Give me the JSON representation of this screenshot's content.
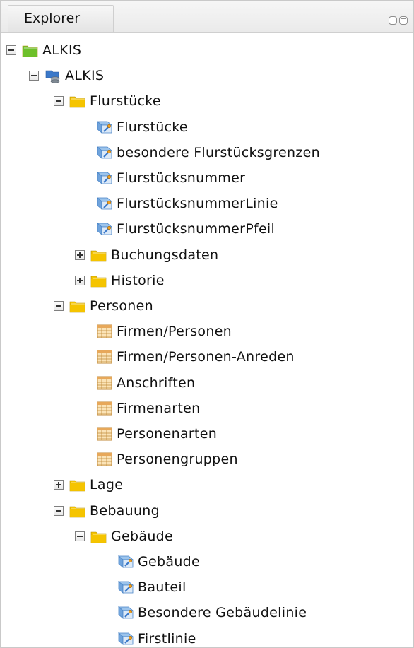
{
  "explorer": {
    "tab_label": "Explorer"
  },
  "icons": {
    "minimize": "minimize-icon",
    "maximize": "maximize-icon",
    "toggle_expanded": "collapse-icon",
    "toggle_collapsed": "expand-icon",
    "folder": "folder-icon",
    "folder_green": "green-folder-icon",
    "database": "database-icon",
    "layer": "map-layer-icon",
    "table": "table-icon"
  },
  "colors": {
    "folder_yellow": "#f5c400",
    "folder_green": "#6fbf2a",
    "layer_blue": "#3a78c9"
  },
  "tree": [
    {
      "label": "ALKIS",
      "icon": "folder_green",
      "toggle": "expanded"
    },
    {
      "label": "ALKIS",
      "icon": "database",
      "toggle": "expanded"
    },
    {
      "label": "Flurstücke",
      "icon": "folder",
      "toggle": "expanded"
    },
    {
      "label": "Flurstücke",
      "icon": "layer",
      "toggle": ""
    },
    {
      "label": "besondere Flurstücksgrenzen",
      "icon": "layer",
      "toggle": ""
    },
    {
      "label": "Flurstücksnummer",
      "icon": "layer",
      "toggle": ""
    },
    {
      "label": "FlurstücksnummerLinie",
      "icon": "layer",
      "toggle": ""
    },
    {
      "label": "FlurstücksnummerPfeil",
      "icon": "layer",
      "toggle": ""
    },
    {
      "label": "Buchungsdaten",
      "icon": "folder",
      "toggle": "collapsed"
    },
    {
      "label": "Historie",
      "icon": "folder",
      "toggle": "collapsed"
    },
    {
      "label": "Personen",
      "icon": "folder",
      "toggle": "expanded"
    },
    {
      "label": "Firmen/Personen",
      "icon": "table",
      "toggle": ""
    },
    {
      "label": "Firmen/Personen-Anreden",
      "icon": "table",
      "toggle": ""
    },
    {
      "label": "Anschriften",
      "icon": "table",
      "toggle": ""
    },
    {
      "label": "Firmenarten",
      "icon": "table",
      "toggle": ""
    },
    {
      "label": "Personenarten",
      "icon": "table",
      "toggle": ""
    },
    {
      "label": "Personengruppen",
      "icon": "table",
      "toggle": ""
    },
    {
      "label": "Lage",
      "icon": "folder",
      "toggle": "collapsed"
    },
    {
      "label": "Bebauung",
      "icon": "folder",
      "toggle": "expanded"
    },
    {
      "label": "Gebäude",
      "icon": "folder",
      "toggle": "expanded"
    },
    {
      "label": "Gebäude",
      "icon": "layer",
      "toggle": ""
    },
    {
      "label": "Bauteil",
      "icon": "layer",
      "toggle": ""
    },
    {
      "label": "Besondere Gebäudelinie",
      "icon": "layer",
      "toggle": ""
    },
    {
      "label": "Firstlinie",
      "icon": "layer",
      "toggle": ""
    }
  ]
}
